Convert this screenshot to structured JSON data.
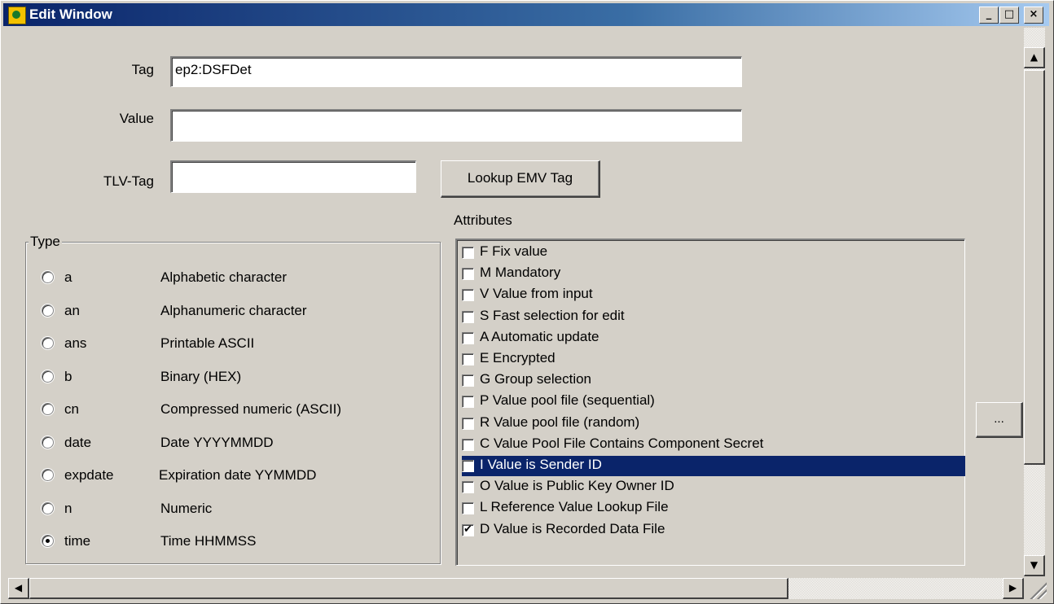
{
  "window": {
    "title": "Edit Window",
    "minimize_glyph": "_",
    "maximize_glyph": "□",
    "close_glyph": "×"
  },
  "fields": {
    "tag_label": "Tag",
    "tag_value": "ep2:DSFDet",
    "value_label": "Value",
    "value_value": "",
    "tlv_label": "TLV-Tag",
    "tlv_value": ""
  },
  "buttons": {
    "lookup_emv": "Lookup EMV Tag",
    "ellipsis": "..."
  },
  "type_group": {
    "caption": "Type",
    "options": [
      {
        "code": "a",
        "description": "Alphabetic character",
        "checked": false
      },
      {
        "code": "an",
        "description": "Alphanumeric character",
        "checked": false
      },
      {
        "code": "ans",
        "description": "Printable ASCII",
        "checked": false
      },
      {
        "code": "b",
        "description": "Binary (HEX)",
        "checked": false
      },
      {
        "code": "cn",
        "description": "Compressed numeric (ASCII)",
        "checked": false
      },
      {
        "code": "date",
        "description": "Date YYYYMMDD",
        "checked": false
      },
      {
        "code": "expdate",
        "description": "Expiration date YYMMDD",
        "checked": false
      },
      {
        "code": "n",
        "description": "Numeric",
        "checked": false
      },
      {
        "code": "time",
        "description": "Time HHMMSS",
        "checked": true
      }
    ]
  },
  "attributes": {
    "caption": "Attributes",
    "items": [
      {
        "label": "F  Fix value",
        "checked": false,
        "selected": false
      },
      {
        "label": "M Mandatory",
        "checked": false,
        "selected": false
      },
      {
        "label": "V  Value from input",
        "checked": false,
        "selected": false
      },
      {
        "label": "S Fast selection for edit",
        "checked": false,
        "selected": false
      },
      {
        "label": "A Automatic update",
        "checked": false,
        "selected": false
      },
      {
        "label": "E Encrypted",
        "checked": false,
        "selected": false
      },
      {
        "label": "G Group selection",
        "checked": false,
        "selected": false
      },
      {
        "label": "P Value pool file (sequential)",
        "checked": false,
        "selected": false
      },
      {
        "label": "R Value pool file (random)",
        "checked": false,
        "selected": false
      },
      {
        "label": "C Value Pool File Contains Component Secret",
        "checked": false,
        "selected": false
      },
      {
        "label": "I Value is Sender ID",
        "checked": false,
        "selected": true
      },
      {
        "label": "O Value is Public Key Owner ID",
        "checked": false,
        "selected": false
      },
      {
        "label": "L Reference Value Lookup File",
        "checked": false,
        "selected": false
      },
      {
        "label": "D Value is Recorded Data File",
        "checked": true,
        "selected": false
      }
    ]
  },
  "scrollbars": {
    "up_arrow": "▲",
    "down_arrow": "▼",
    "left_arrow": "◀",
    "right_arrow": "▶"
  },
  "colors": {
    "selection_bg": "#0a246a",
    "face": "#d4d0c8"
  }
}
